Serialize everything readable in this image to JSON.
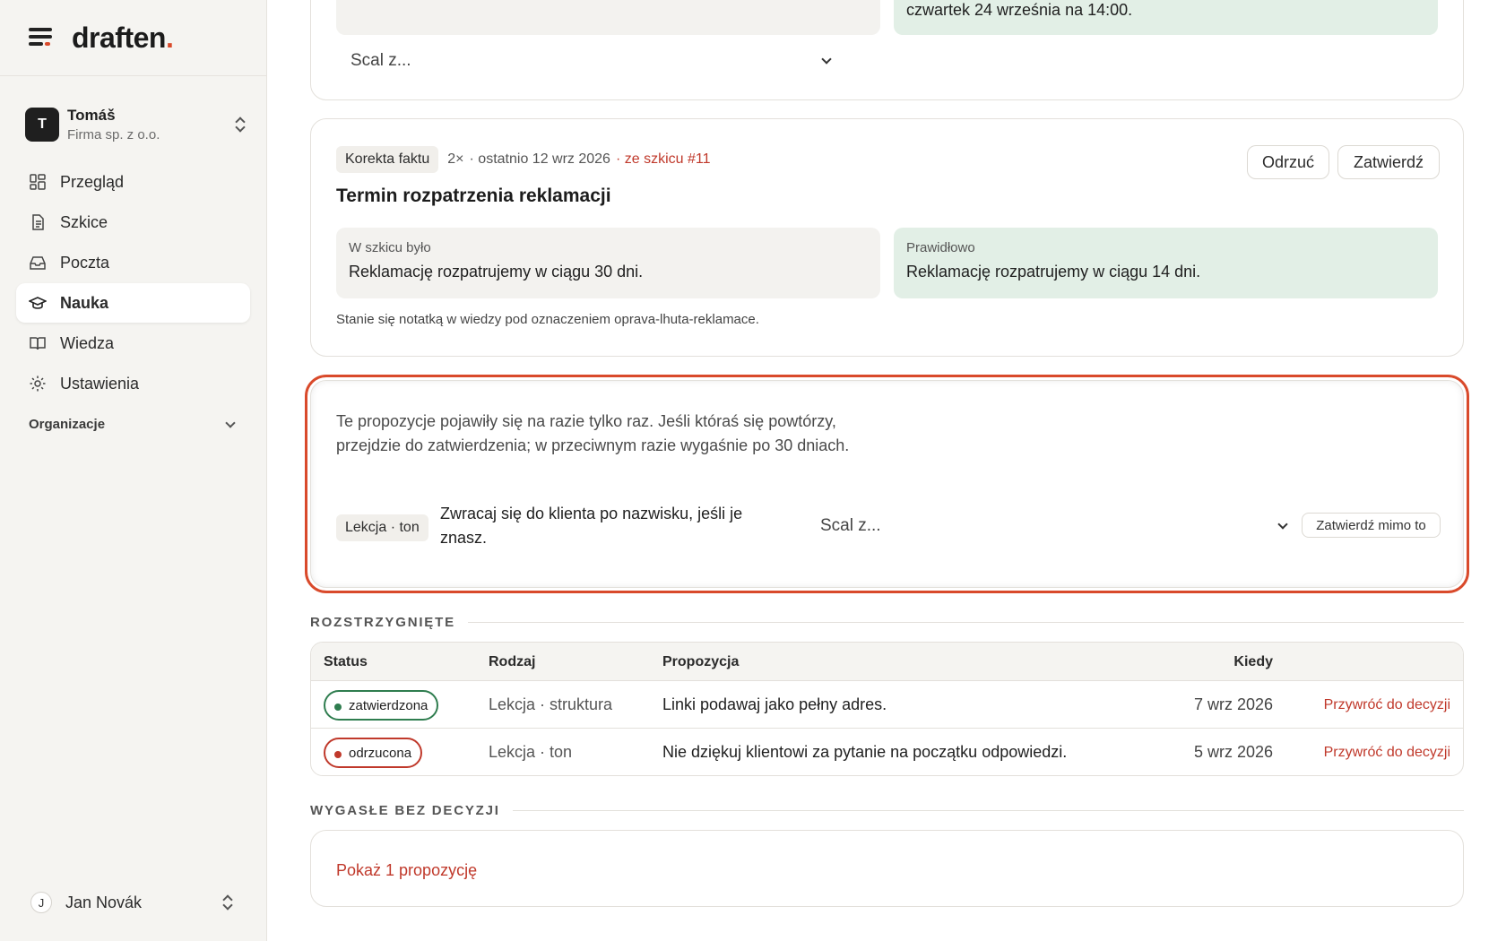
{
  "sidebar": {
    "brand": "draften",
    "account": {
      "initial": "T",
      "name": "Tomáš",
      "company": "Firma sp. z o.o."
    },
    "nav": [
      {
        "label": "Przegląd",
        "icon": "dashboard-icon"
      },
      {
        "label": "Szkice",
        "icon": "document-icon"
      },
      {
        "label": "Poczta",
        "icon": "inbox-icon"
      },
      {
        "label": "Nauka",
        "icon": "graduation-cap-icon",
        "active": true
      },
      {
        "label": "Wiedza",
        "icon": "book-icon"
      },
      {
        "label": "Ustawienia",
        "icon": "gear-icon"
      }
    ],
    "org_label": "Organizacje",
    "user": {
      "initial": "J",
      "name": "Jan Novák"
    }
  },
  "card1": {
    "correct_text": "czwartek 24 września na 14:00.",
    "merge_placeholder": "Scal z..."
  },
  "card2": {
    "tag": "Korekta faktu",
    "count": "2×",
    "last": "· ostatnio 12 wrz 2026",
    "source": "· ze szkicu #11",
    "reject_label": "Odrzuć",
    "approve_label": "Zatwierdź",
    "title": "Termin rozpatrzenia reklamacji",
    "draft_caption": "W szkicu było",
    "draft_text": "Reklamację rozpatrujemy w ciągu 30 dni.",
    "correct_caption": "Prawidłowo",
    "correct_text": "Reklamację rozpatrujemy w ciągu 14 dni.",
    "note": "Stanie się notatką w wiedzy pod oznaczeniem oprava-lhuta-reklamace."
  },
  "card3": {
    "paragraph": "Te propozycje pojawiły się na razie tylko raz. Jeśli któraś się powtórzy, przejdzie do zatwierdzenia; w przeciwnym razie wygaśnie po 30 dniach.",
    "tag": "Lekcja · ton",
    "proposal": "Zwracaj się do klienta po nazwisku, jeśli je znasz.",
    "merge_placeholder": "Scal z...",
    "approve_anyway_label": "Zatwierdź mimo to"
  },
  "resolved": {
    "label": "ROZSTRZYGNIĘTE",
    "headers": {
      "status": "Status",
      "kind": "Rodzaj",
      "proposal": "Propozycja",
      "when": "Kiedy"
    },
    "rows": [
      {
        "status": "zatwierdzona",
        "kind": "Lekcja · struktura",
        "proposal": "Linki podawaj jako pełny adres.",
        "when": "7 wrz 2026",
        "action": "Przywróć do decyzji"
      },
      {
        "status": "odrzucona",
        "kind": "Lekcja · ton",
        "proposal": "Nie dziękuj klientowi za pytanie na początku odpowiedzi.",
        "when": "5 wrz 2026",
        "action": "Przywróć do decyzji"
      }
    ]
  },
  "expired": {
    "label": "WYGASŁE BEZ DECYZJI",
    "show_link": "Pokaż 1 propozycję"
  },
  "colors": {
    "accent": "#d94a2b",
    "approved": "#2f7d4f",
    "rejected": "#c0392b",
    "correct_bg": "#e2efe6"
  }
}
